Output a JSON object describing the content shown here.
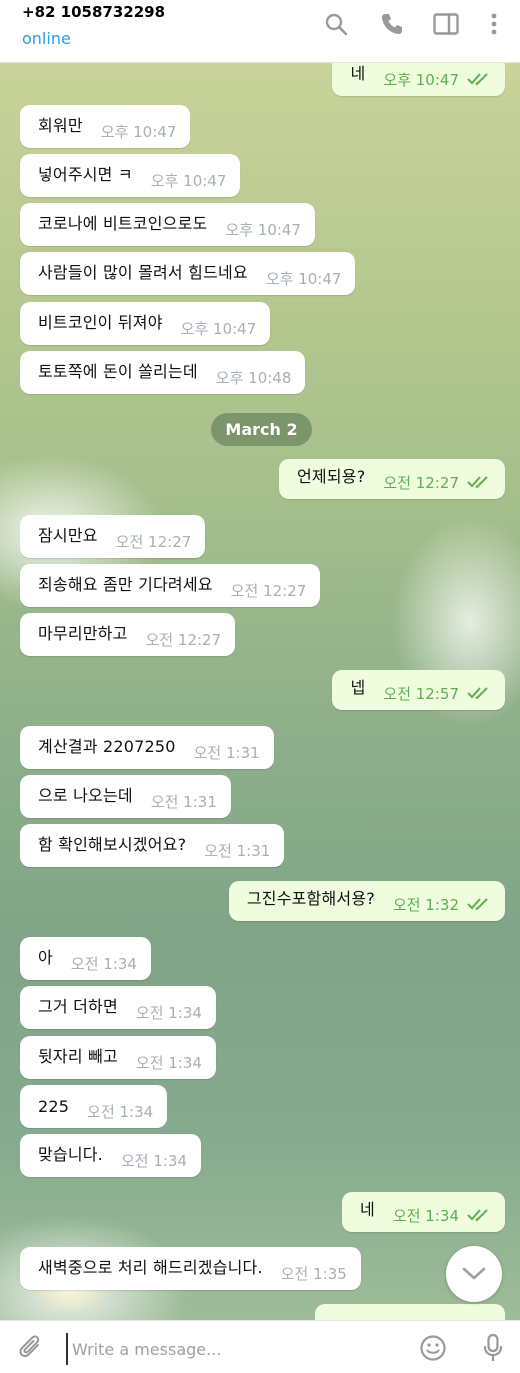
{
  "header": {
    "title": "+82 1058732298",
    "status": "online",
    "icons": [
      "search-icon",
      "phone-icon",
      "sidebar-toggle-icon",
      "more-vert-icon"
    ]
  },
  "date_separator": "March 2",
  "messages": [
    {
      "dir": "out",
      "text": "네",
      "time": "오후 10:47",
      "read": true
    },
    {
      "dir": "in",
      "text": "회워만",
      "time": "오후 10:47"
    },
    {
      "dir": "in",
      "text": "넣어주시면 ㅋ",
      "time": "오후 10:47"
    },
    {
      "dir": "in",
      "text": "코로나에 비트코인으로도",
      "time": "오후 10:47"
    },
    {
      "dir": "in",
      "text": "사람들이 많이 몰려서 힘드네요",
      "time": "오후 10:47"
    },
    {
      "dir": "in",
      "text": "비트코인이 뒤져야",
      "time": "오후 10:47"
    },
    {
      "dir": "in",
      "text": "토토쪽에 돈이 쏠리는데",
      "time": "오후 10:48"
    },
    {
      "dir": "out",
      "text": "언제되용?",
      "time": "오전 12:27",
      "read": true
    },
    {
      "dir": "in",
      "text": "잠시만요",
      "time": "오전 12:27"
    },
    {
      "dir": "in",
      "text": "죄송해요 좀만 기다려세요",
      "time": "오전 12:27"
    },
    {
      "dir": "in",
      "text": "마무리만하고",
      "time": "오전 12:27"
    },
    {
      "dir": "out",
      "text": "넵",
      "time": "오전 12:57",
      "read": true
    },
    {
      "dir": "in",
      "text": "계산결과 2207250",
      "time": "오전 1:31"
    },
    {
      "dir": "in",
      "text": "으로 나오는데",
      "time": "오전 1:31"
    },
    {
      "dir": "in",
      "text": "함 확인해보시겠어요?",
      "time": "오전 1:31"
    },
    {
      "dir": "out",
      "text": "그진수포함해서용?",
      "time": "오전 1:32",
      "read": true
    },
    {
      "dir": "in",
      "text": "아",
      "time": "오전 1:34"
    },
    {
      "dir": "in",
      "text": "그거 더하면",
      "time": "오전 1:34"
    },
    {
      "dir": "in",
      "text": "뒷자리 빼고",
      "time": "오전 1:34"
    },
    {
      "dir": "in",
      "text": "225",
      "time": "오전 1:34"
    },
    {
      "dir": "in",
      "text": "맞습니다.",
      "time": "오전 1:34"
    },
    {
      "dir": "out",
      "text": "네",
      "time": "오전 1:34",
      "read": true
    },
    {
      "dir": "in",
      "text": "새벽중으로 처리 해드리겠습니다.",
      "time": "오전 1:35"
    }
  ],
  "composer": {
    "placeholder": "Write a message...",
    "value": ""
  },
  "colors": {
    "link_blue": "#2a9fd8",
    "outgoing_bubble": "#effdde",
    "outgoing_time": "#5fae4f",
    "incoming_bubble": "#ffffff"
  }
}
